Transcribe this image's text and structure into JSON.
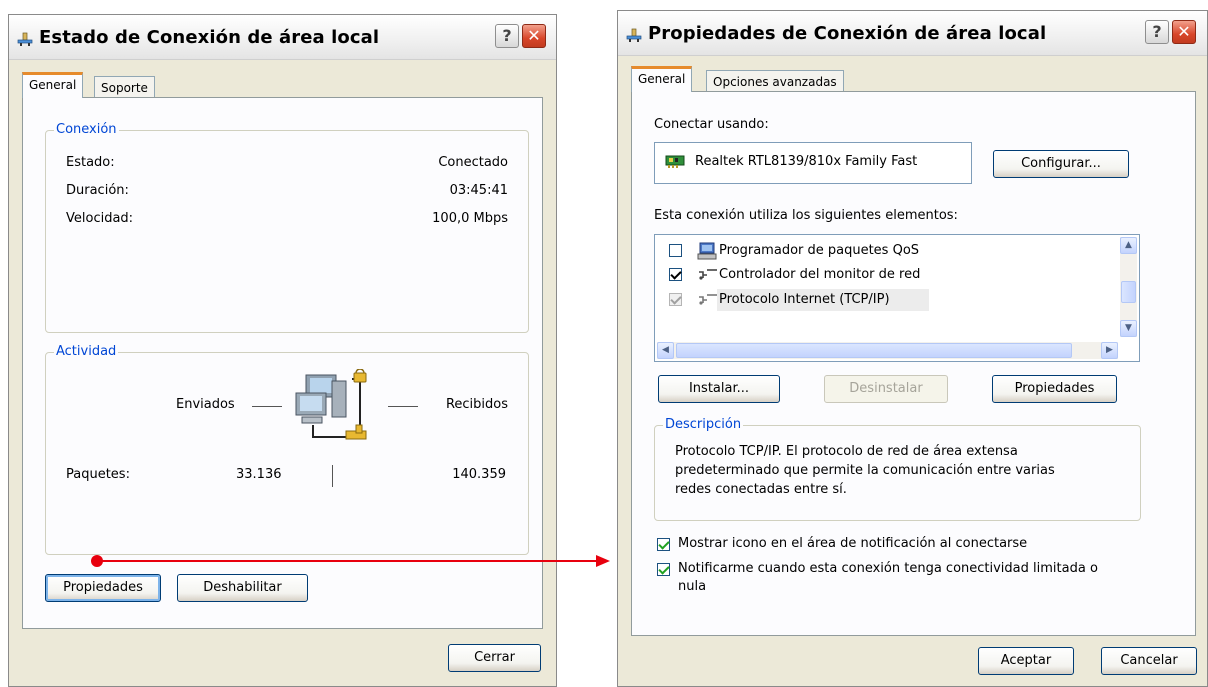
{
  "left_window": {
    "title": "Estado de Conexión de área local",
    "tabs": [
      "General",
      "Soporte"
    ],
    "connection": {
      "legend": "Conexión",
      "rows": [
        {
          "label": "Estado:",
          "value": "Conectado"
        },
        {
          "label": "Duración:",
          "value": "03:45:41"
        },
        {
          "label": "Velocidad:",
          "value": "100,0 Mbps"
        }
      ]
    },
    "activity": {
      "legend": "Actividad",
      "sent_label": "Enviados",
      "received_label": "Recibidos",
      "packets_label": "Paquetes:",
      "packets_sent": "33.136",
      "packets_received": "140.359"
    },
    "buttons": {
      "properties": "Propiedades",
      "disable": "Deshabilitar",
      "close": "Cerrar"
    }
  },
  "right_window": {
    "title": "Propiedades de Conexión de área local",
    "tabs": [
      "General",
      "Opciones avanzadas"
    ],
    "connect_using_label": "Conectar usando:",
    "adapter_name": "Realtek RTL8139/810x Family Fast",
    "configure_button": "Configurar...",
    "items_label": "Esta conexión utiliza los siguientes elementos:",
    "items": [
      {
        "label": "Programador de paquetes QoS",
        "checked": false
      },
      {
        "label": "Controlador del monitor de red",
        "checked": true
      },
      {
        "label": "Protocolo Internet (TCP/IP)",
        "checked": true
      }
    ],
    "buttons": {
      "install": "Instalar...",
      "uninstall": "Desinstalar",
      "properties": "Propiedades",
      "accept": "Aceptar",
      "cancel": "Cancelar"
    },
    "description": {
      "legend": "Descripción",
      "lines": [
        "Protocolo TCP/IP. El protocolo de red de área extensa",
        "predeterminado que permite la comunicación entre varias",
        "redes conectadas entre sí."
      ]
    },
    "options": [
      {
        "label": "Mostrar icono en el área de notificación al conectarse",
        "checked": true
      },
      {
        "label_lines": [
          "Notificarme cuando esta conexión tenga conectividad limitada o",
          "nula"
        ],
        "checked": true
      }
    ]
  },
  "colors": {
    "annotation_arrow": "#e8000e",
    "group_legend": "#0046d5",
    "tab_highlight": "#e68b2c"
  }
}
